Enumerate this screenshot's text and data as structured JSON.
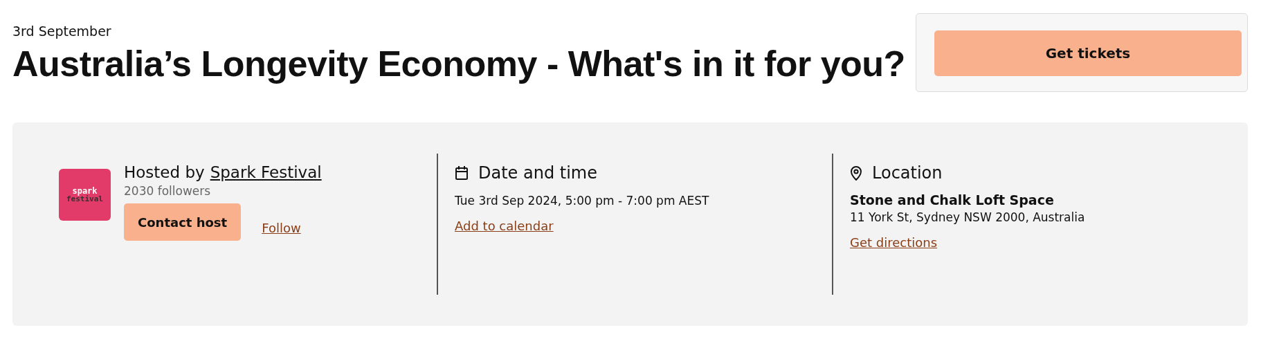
{
  "event": {
    "date_label": "3rd September",
    "title": "Australia’s Longevity Economy - What's in it for you?"
  },
  "tickets": {
    "button": "Get tickets"
  },
  "host": {
    "logo_lines": [
      "spark",
      "festival"
    ],
    "prefix": "Hosted by",
    "name": "Spark Festival",
    "followers": "2030 followers",
    "contact_button": "Contact host",
    "follow_link": "Follow"
  },
  "date_time": {
    "heading": "Date and time",
    "text": "Tue 3rd Sep 2024, 5:00 pm - 7:00 pm AEST",
    "link": "Add to calendar"
  },
  "location": {
    "heading": "Location",
    "venue": "Stone and Chalk Loft Space",
    "address": "11 York St, Sydney NSW 2000, Australia",
    "link": "Get directions"
  }
}
